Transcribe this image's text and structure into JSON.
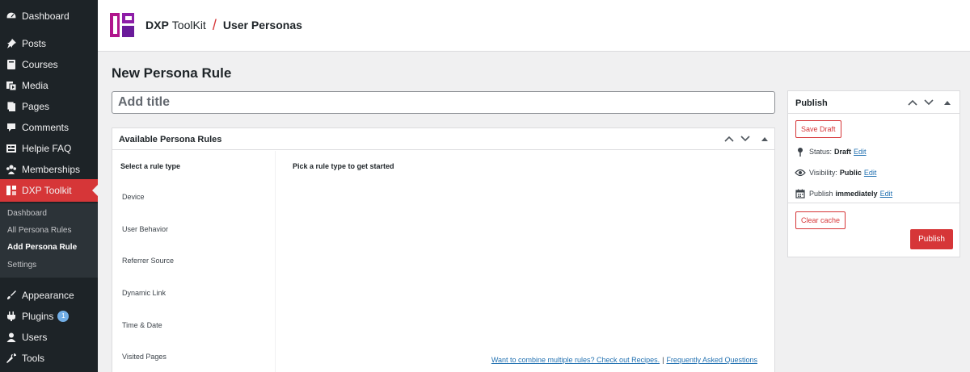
{
  "sidebar": {
    "items": [
      {
        "label": "Dashboard",
        "icon": "dashboard-icon"
      },
      {
        "label": "Posts",
        "icon": "pin-icon"
      },
      {
        "label": "Courses",
        "icon": "book-icon"
      },
      {
        "label": "Media",
        "icon": "media-icon"
      },
      {
        "label": "Pages",
        "icon": "pages-icon"
      },
      {
        "label": "Comments",
        "icon": "comment-icon"
      },
      {
        "label": "Helpie FAQ",
        "icon": "faq-icon"
      },
      {
        "label": "Memberships",
        "icon": "groups-icon"
      },
      {
        "label": "DXP Toolkit",
        "icon": "dxp-logo-icon"
      }
    ],
    "submenu": [
      {
        "label": "Dashboard"
      },
      {
        "label": "All Persona Rules"
      },
      {
        "label": "Add Persona Rule"
      },
      {
        "label": "Settings"
      }
    ],
    "bottom_items": [
      {
        "label": "Appearance",
        "icon": "brush-icon"
      },
      {
        "label": "Plugins",
        "icon": "plugin-icon",
        "badge": "1"
      },
      {
        "label": "Users",
        "icon": "user-icon"
      },
      {
        "label": "Tools",
        "icon": "wrench-icon"
      }
    ]
  },
  "header": {
    "brand_bold": "DXP",
    "brand_rest": "ToolKit",
    "separator": "/",
    "page_name": "User Personas"
  },
  "main": {
    "heading": "New Persona Rule",
    "title_placeholder": "Add title",
    "rules_box": {
      "title": "Available Persona Rules",
      "left_heading": "Select a rule type",
      "right_heading": "Pick a rule type to get started",
      "rule_types": [
        "Device",
        "User Behavior",
        "Referrer Source",
        "Dynamic Link",
        "Time & Date",
        "Visited Pages"
      ],
      "footer_link_recipes": "Want to combine multiple rules? Check out Recipes.",
      "footer_sep": "|",
      "footer_link_faq": "Frequently Asked Questions"
    }
  },
  "publish": {
    "title": "Publish",
    "save_draft": "Save Draft",
    "status_label": "Status:",
    "status_value": "Draft",
    "visibility_label": "Visibility:",
    "visibility_value": "Public",
    "publish_label": "Publish",
    "publish_value": "immediately",
    "edit": "Edit",
    "clear_cache": "Clear cache",
    "publish_button": "Publish"
  },
  "colors": {
    "sidebar_bg": "#1d2327",
    "accent": "#d63638",
    "link": "#2271b1",
    "brand_magenta": "#b0158c",
    "brand_purple": "#6a1b9a"
  }
}
